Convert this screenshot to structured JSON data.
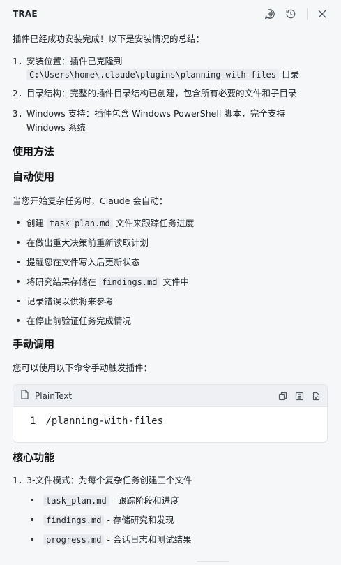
{
  "header": {
    "brand": "TRAE",
    "icons": [
      "add-chat-icon",
      "history-icon",
      "close-icon"
    ]
  },
  "intro": "插件已经成功安装完成！以下是安装情况的总结：",
  "summary": [
    {
      "num": "1.",
      "label": "安装位置：插件已克隆到",
      "path": "C:\\Users\\home\\.claude\\plugins\\planning-with-files",
      "suffix": "目录"
    },
    {
      "num": "2.",
      "text": "目录结构：完整的插件目录结构已创建，包含所有必要的文件和子目录"
    },
    {
      "num": "3.",
      "text_line1": "Windows 支持：插件包含 Windows PowerShell 脚本，完全支持",
      "text_line2": "Windows 系统"
    }
  ],
  "usage_title": "使用方法",
  "auto_title": "自动使用",
  "auto_intro": "当您开始复杂任务时，Claude 会自动：",
  "auto_items": [
    {
      "pre": "创建",
      "code": "task_plan.md",
      "post": "文件来跟踪任务进度"
    },
    {
      "text": "在做出重大决策前重新读取计划"
    },
    {
      "text": "提醒您在文件写入后更新状态"
    },
    {
      "pre": "将研究结果存储在",
      "code": "findings.md",
      "post": "文件中"
    },
    {
      "text": "记录错误以供将来参考"
    },
    {
      "text": "在停止前验证任务完成情况"
    }
  ],
  "manual_title": "手动调用",
  "manual_intro": "您可以使用以下命令手动触发插件：",
  "codeblock": {
    "language": "PlainText",
    "line_number": "1",
    "line": "/planning-with-files"
  },
  "core_title": "核心功能",
  "core_items": [
    {
      "num": "1.",
      "text": "3-文件模式：为每个复杂任务创建三个文件"
    }
  ],
  "core_sub": [
    {
      "code": "task_plan.md",
      "post": "- 跟踪阶段和进度"
    },
    {
      "code": "findings.md",
      "post": "- 存储研究和发现"
    },
    {
      "code": "progress.md",
      "post": "- 会话日志和测试结果"
    }
  ]
}
